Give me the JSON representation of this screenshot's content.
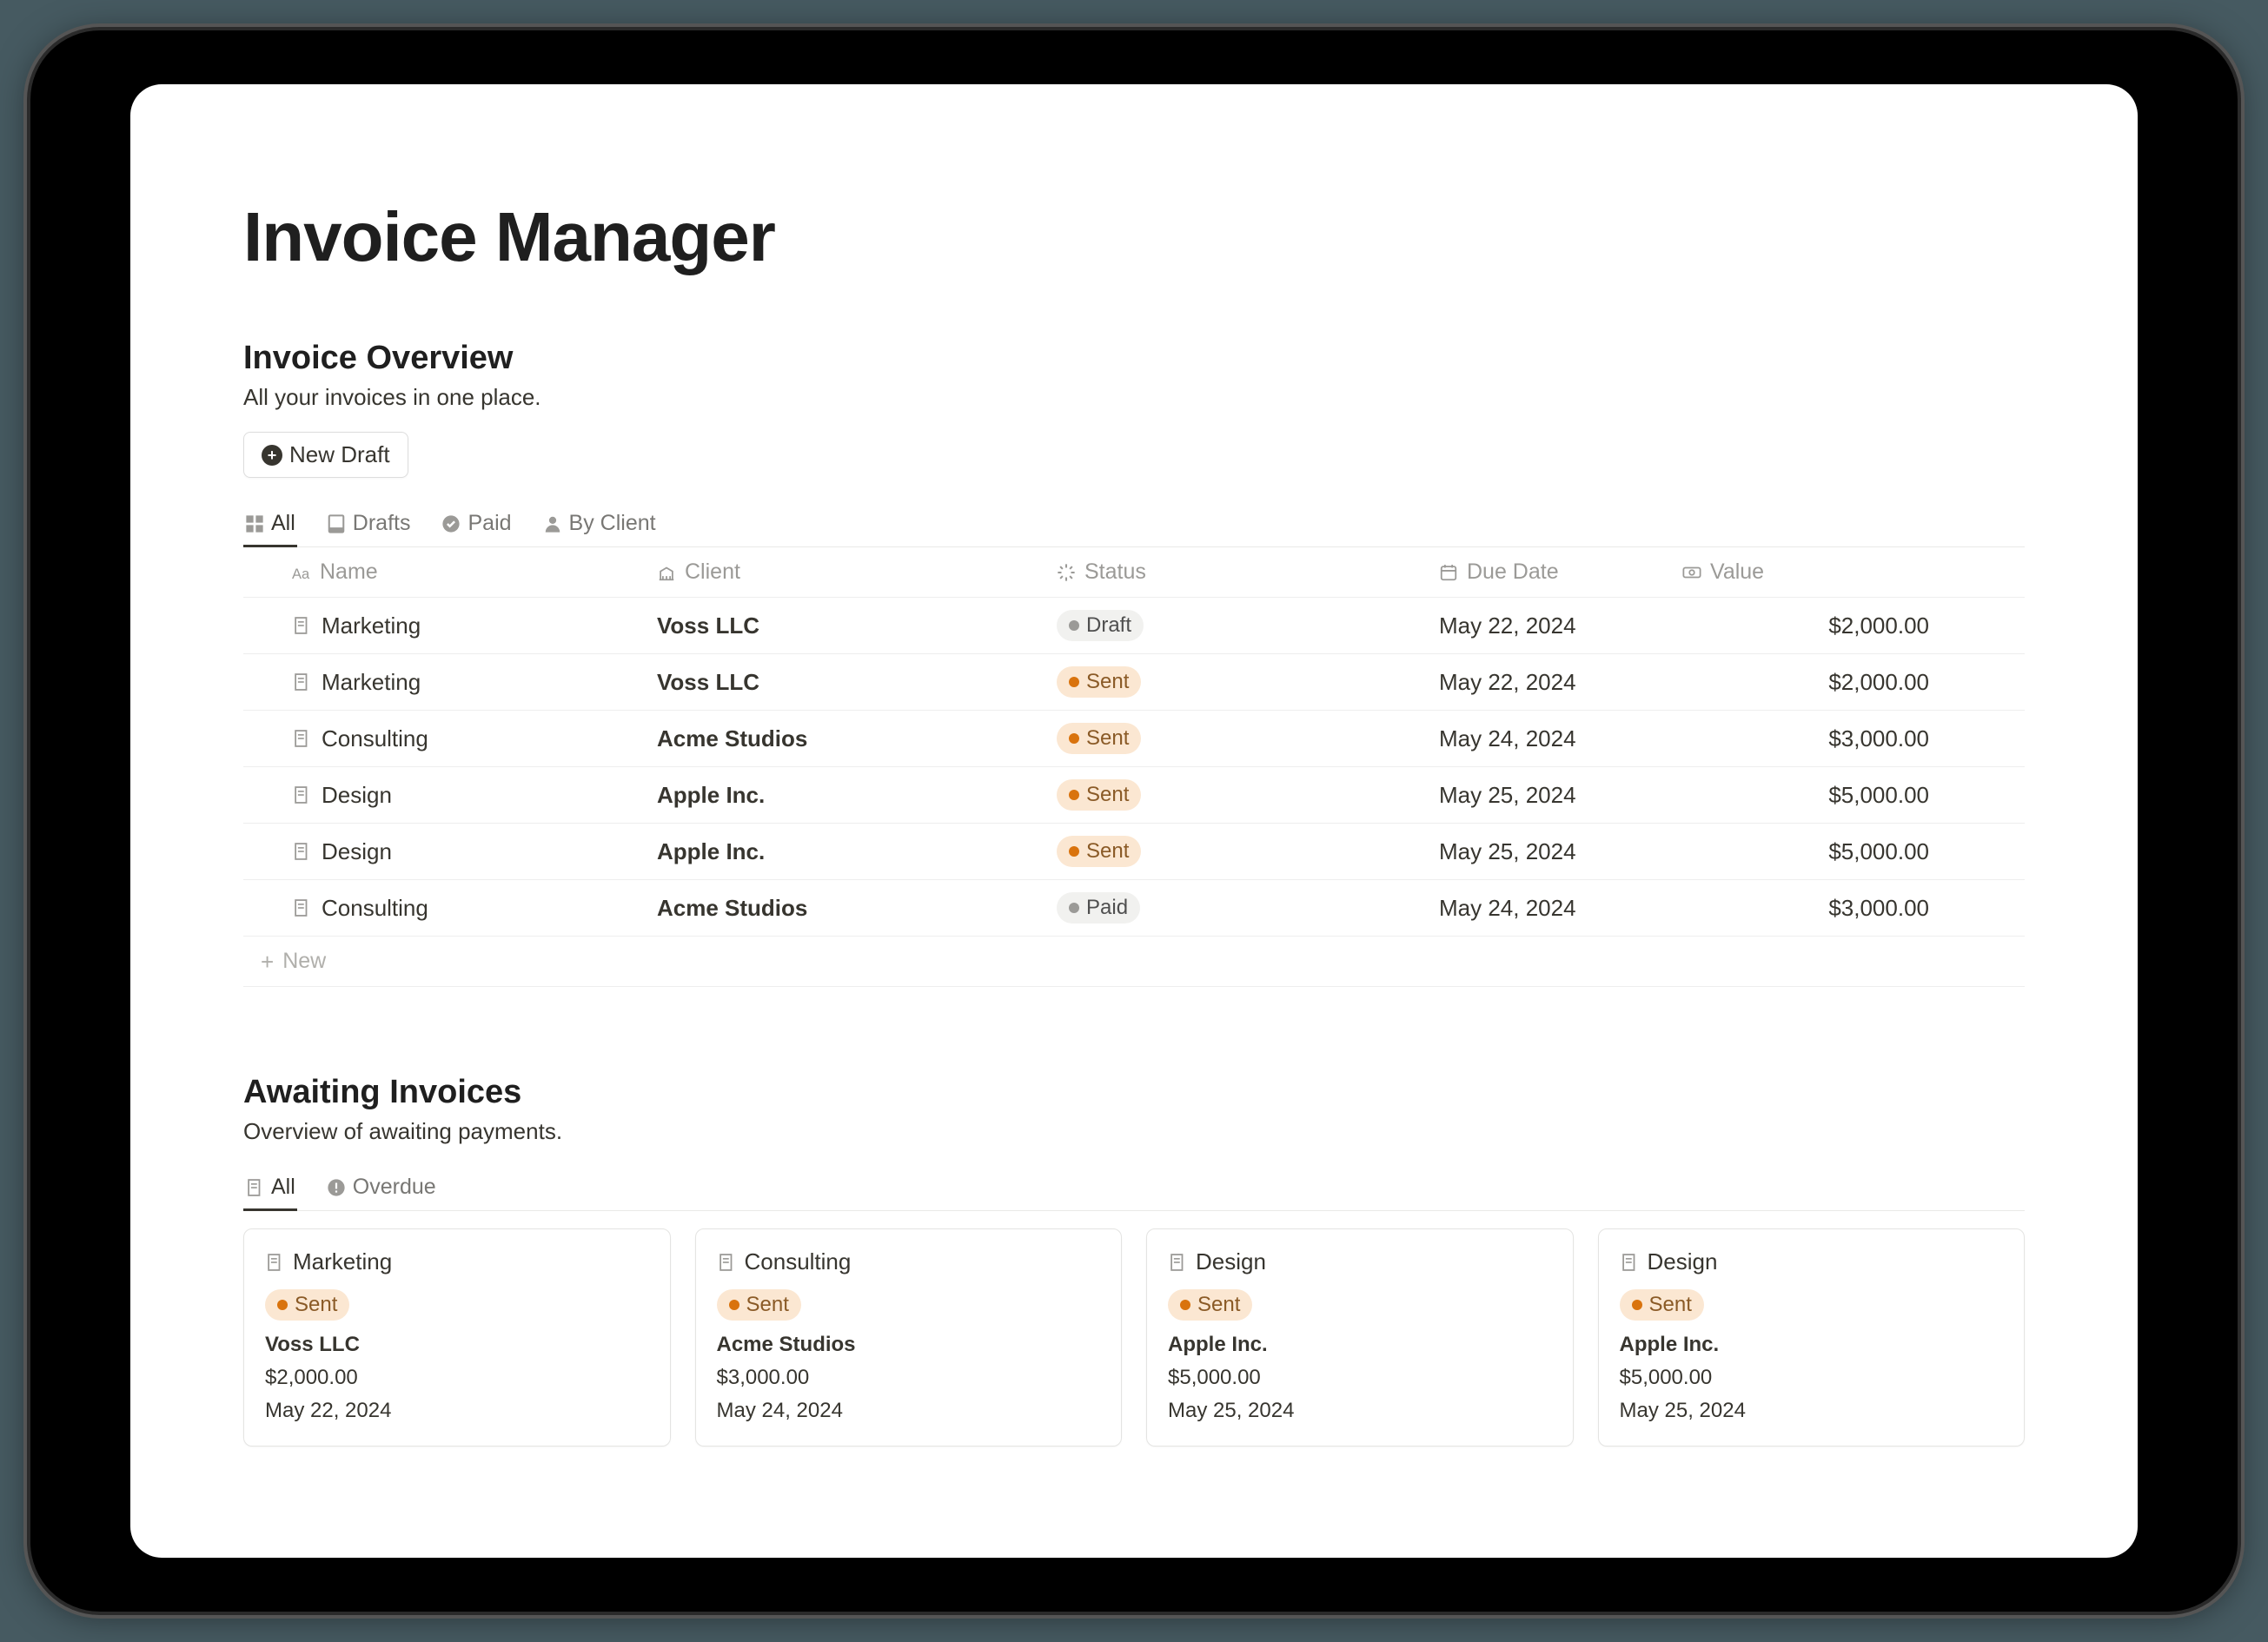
{
  "page": {
    "title": "Invoice Manager"
  },
  "overview": {
    "title": "Invoice Overview",
    "subtitle": "All your invoices in one place.",
    "newDraftLabel": "New Draft",
    "tabs": [
      {
        "label": "All"
      },
      {
        "label": "Drafts"
      },
      {
        "label": "Paid"
      },
      {
        "label": "By Client"
      }
    ],
    "columns": {
      "name": "Name",
      "client": "Client",
      "status": "Status",
      "dueDate": "Due Date",
      "value": "Value"
    },
    "rows": [
      {
        "name": "Marketing",
        "client": "Voss LLC",
        "status": "Draft",
        "statusClass": "draft",
        "dueDate": "May 22, 2024",
        "value": "$2,000.00"
      },
      {
        "name": "Marketing",
        "client": "Voss LLC",
        "status": "Sent",
        "statusClass": "sent",
        "dueDate": "May 22, 2024",
        "value": "$2,000.00"
      },
      {
        "name": "Consulting",
        "client": "Acme Studios",
        "status": "Sent",
        "statusClass": "sent",
        "dueDate": "May 24, 2024",
        "value": "$3,000.00"
      },
      {
        "name": "Design",
        "client": "Apple Inc.",
        "status": "Sent",
        "statusClass": "sent",
        "dueDate": "May 25, 2024",
        "value": "$5,000.00"
      },
      {
        "name": "Design",
        "client": "Apple Inc.",
        "status": "Sent",
        "statusClass": "sent",
        "dueDate": "May 25, 2024",
        "value": "$5,000.00"
      },
      {
        "name": "Consulting",
        "client": "Acme Studios",
        "status": "Paid",
        "statusClass": "paid",
        "dueDate": "May 24, 2024",
        "value": "$3,000.00"
      }
    ],
    "newRowLabel": "New"
  },
  "awaiting": {
    "title": "Awaiting Invoices",
    "subtitle": "Overview of awaiting payments.",
    "tabs": [
      {
        "label": "All"
      },
      {
        "label": "Overdue"
      }
    ],
    "cards": [
      {
        "name": "Marketing",
        "status": "Sent",
        "statusClass": "sent",
        "client": "Voss LLC",
        "value": "$2,000.00",
        "dueDate": "May 22, 2024"
      },
      {
        "name": "Consulting",
        "status": "Sent",
        "statusClass": "sent",
        "client": "Acme Studios",
        "value": "$3,000.00",
        "dueDate": "May 24, 2024"
      },
      {
        "name": "Design",
        "status": "Sent",
        "statusClass": "sent",
        "client": "Apple Inc.",
        "value": "$5,000.00",
        "dueDate": "May 25, 2024"
      },
      {
        "name": "Design",
        "status": "Sent",
        "statusClass": "sent",
        "client": "Apple Inc.",
        "value": "$5,000.00",
        "dueDate": "May 25, 2024"
      }
    ]
  }
}
